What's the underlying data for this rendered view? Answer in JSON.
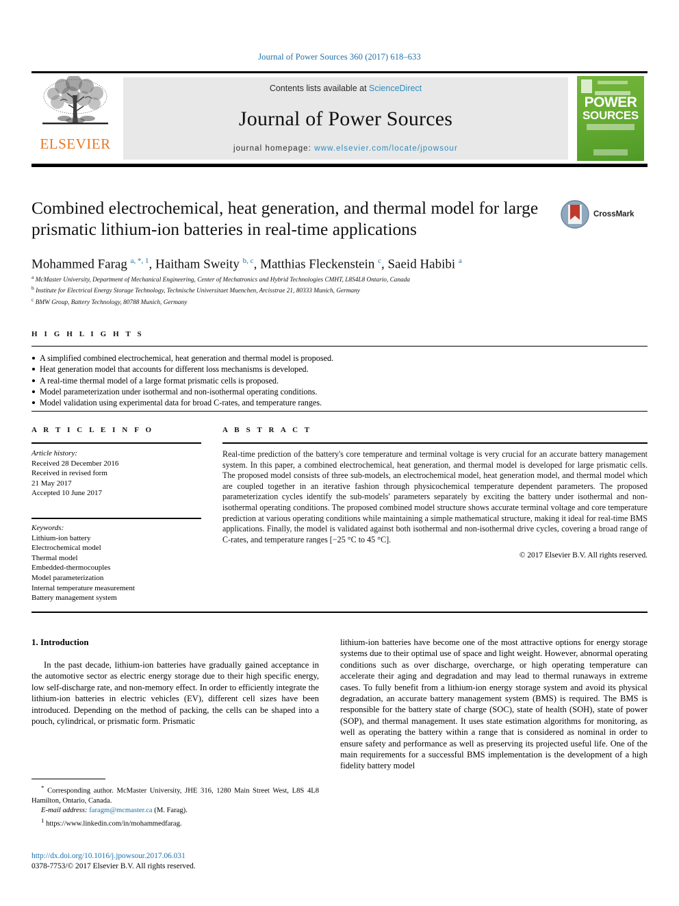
{
  "running_head": "Journal of Power Sources 360 (2017) 618–633",
  "masthead": {
    "publisher_name": "ELSEVIER",
    "contents_prefix": "Contents lists available at",
    "contents_link": "ScienceDirect",
    "journal_name": "Journal of Power Sources",
    "homepage_prefix": "journal homepage:",
    "homepage_url": "www.elsevier.com/locate/jpowsour",
    "cover": {
      "line1": "POWER",
      "line2": "SOURCES"
    },
    "colors": {
      "link": "#2b8cbe",
      "elsevier_orange": "#E87722",
      "cover_green": "#69ae33",
      "panel_gray": "#e8e8e8"
    }
  },
  "article": {
    "title": "Combined electrochemical, heat generation, and thermal model for large prismatic lithium-ion batteries in real-time applications",
    "crossmark_label": "CrossMark",
    "authors_html": "Mohammed Farag <sup>a, *, 1</sup>, Haitham Sweity <sup>b, c</sup>, Matthias Fleckenstein <sup>c</sup>, Saeid Habibi <sup>a</sup>",
    "affiliations": [
      {
        "marker": "a",
        "text": "McMaster University, Department of Mechanical Engineering, Center of Mechatronics and Hybrid Technologies CMHT, L8S4L8 Ontario, Canada"
      },
      {
        "marker": "b",
        "text": "Institute for Electrical Energy Storage Technology, Technische Universitaet Muenchen, Arcisstrae 21, 80333 Munich, Germany"
      },
      {
        "marker": "c",
        "text": "BMW Group, Battery Technology, 80788 Munich, Germany"
      }
    ]
  },
  "highlights": {
    "heading": "H I G H L I G H T S",
    "items": [
      "A simplified combined electrochemical, heat generation and thermal model is proposed.",
      "Heat generation model that accounts for different loss mechanisms is developed.",
      "A real-time thermal model of a large format prismatic cells is proposed.",
      "Model parameterization under isothermal and non-isothermal operating conditions.",
      "Model validation using experimental data for broad C-rates, and temperature ranges."
    ]
  },
  "article_info": {
    "heading": "A R T I C L E   I N F O",
    "history_label": "Article history:",
    "history_lines": [
      "Received 28 December 2016",
      "Received in revised form",
      "21 May 2017",
      "Accepted 10 June 2017"
    ],
    "keywords_label": "Keywords:",
    "keywords": [
      "Lithium-ion battery",
      "Electrochemical model",
      "Thermal model",
      "Embedded-thermocouples",
      "Model parameterization",
      "Internal temperature measurement",
      "Battery management system"
    ]
  },
  "abstract": {
    "heading": "A B S T R A C T",
    "text": "Real-time prediction of the battery's core temperature and terminal voltage is very crucial for an accurate battery management system. In this paper, a combined electrochemical, heat generation, and thermal model is developed for large prismatic cells. The proposed model consists of three sub-models, an electrochemical model, heat generation model, and thermal model which are coupled together in an iterative fashion through physicochemical temperature dependent parameters. The proposed parameterization cycles identify the sub-models' parameters separately by exciting the battery under isothermal and non-isothermal operating conditions. The proposed combined model structure shows accurate terminal voltage and core temperature prediction at various operating conditions while maintaining a simple mathematical structure, making it ideal for real-time BMS applications. Finally, the model is validated against both isothermal and non-isothermal drive cycles, covering a broad range of C-rates, and temperature ranges [−25 °C to 45 °C].",
    "copyright": "© 2017 Elsevier B.V. All rights reserved."
  },
  "introduction": {
    "section_title": "1.  Introduction",
    "left_paragraph": "In the past decade, lithium-ion batteries have gradually gained acceptance in the automotive sector as electric energy storage due to their high specific energy, low self-discharge rate, and non-memory effect. In order to efficiently integrate the lithium-ion batteries in electric vehicles (EV), different cell sizes have been introduced. Depending on the method of packing, the cells can be shaped into a pouch, cylindrical, or prismatic form. Prismatic",
    "right_paragraph": "lithium-ion batteries have become one of the most attractive options for energy storage systems due to their optimal use of space and light weight. However, abnormal operating conditions such as over discharge, overcharge, or high operating temperature can accelerate their aging and degradation and may lead to thermal runaways in extreme cases. To fully benefit from a lithium-ion energy storage system and avoid its physical degradation, an accurate battery management system (BMS) is required. The BMS is responsible for the battery state of charge (SOC), state of health (SOH), state of power (SOP), and thermal management. It uses state estimation algorithms for monitoring, as well as operating the battery within a range that is considered as nominal in order to ensure safety and performance as well as preserving its projected useful life. One of the main requirements for a successful BMS implementation is the development of a high fidelity battery model"
  },
  "footnotes": {
    "corresponding_marker": "*",
    "corresponding_text": "Corresponding author. McMaster University, JHE 316, 1280 Main Street West, L8S 4L8 Hamilton, Ontario, Canada.",
    "email_label": "E-mail address:",
    "email": "faragm@mcmaster.ca",
    "email_owner": "(M. Farag).",
    "note_marker": "1",
    "note_text": "https://www.linkedin.com/in/mohammedfarag.",
    "doi": "http://dx.doi.org/10.1016/j.jpowsour.2017.06.031",
    "issn_line": "0378-7753/© 2017 Elsevier B.V. All rights reserved."
  }
}
